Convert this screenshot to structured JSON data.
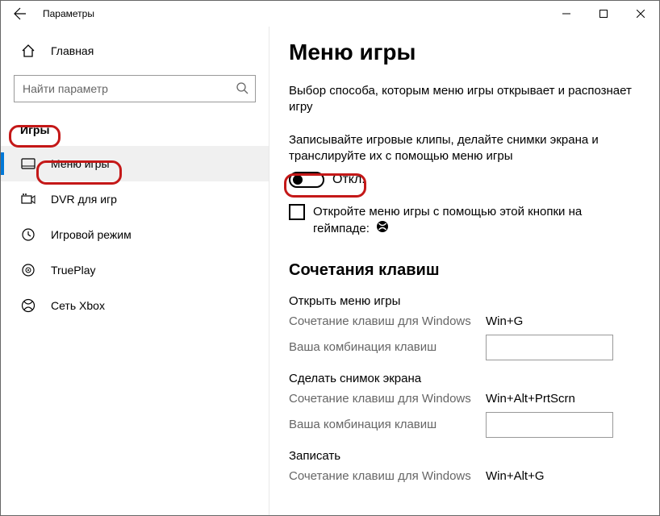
{
  "window": {
    "title": "Параметры"
  },
  "sidebar": {
    "home": "Главная",
    "search_placeholder": "Найти параметр",
    "category": "Игры",
    "items": [
      {
        "label": "Меню игры"
      },
      {
        "label": "DVR для игр"
      },
      {
        "label": "Игровой режим"
      },
      {
        "label": "TruePlay"
      },
      {
        "label": "Сеть Xbox"
      }
    ]
  },
  "main": {
    "title": "Меню игры",
    "desc": "Выбор способа, которым меню игры открывает и распознает игру",
    "toggle_desc": "Записывайте игровые клипы, делайте снимки экрана и транслируйте их с помощью меню игры",
    "toggle_state": "Откл.",
    "checkbox_text": "Откройте меню игры с помощью этой кнопки на геймпаде:",
    "shortcuts_header": "Сочетания клавиш",
    "win_shortcut_label": "Сочетание клавиш для Windows",
    "user_shortcut_label": "Ваша комбинация клавиш",
    "groups": [
      {
        "name": "Открыть меню игры",
        "win": "Win+G"
      },
      {
        "name": "Сделать снимок экрана",
        "win": "Win+Alt+PrtScrn"
      },
      {
        "name": "Записать",
        "win": "Win+Alt+G"
      }
    ]
  }
}
